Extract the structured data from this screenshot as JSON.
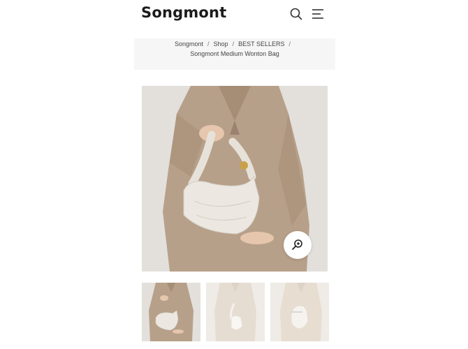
{
  "header": {
    "brand": "Songmont",
    "search_icon": "search-icon",
    "menu_icon": "menu-icon"
  },
  "breadcrumb": {
    "items": [
      "Songmont",
      "Shop",
      "BEST SELLERS"
    ],
    "current": "Songmont Medium Wonton Bag"
  },
  "gallery": {
    "zoom_icon": "zoom-in-icon",
    "thumbnails": [
      "thumbnail-1",
      "thumbnail-2",
      "thumbnail-3"
    ]
  }
}
